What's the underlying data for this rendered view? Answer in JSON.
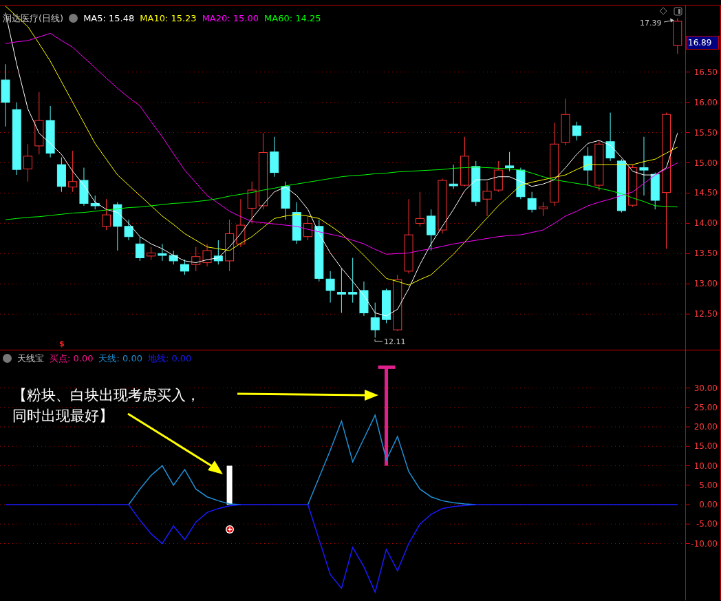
{
  "price_panel": {
    "title": "润达医疗(日线)",
    "moving_averages": [
      {
        "label": "MA5: 15.48",
        "color": "#ffffff"
      },
      {
        "label": "MA10: 15.23",
        "color": "#ffff00"
      },
      {
        "label": "MA20: 15.00",
        "color": "#ff00ff"
      },
      {
        "label": "MA60: 14.25",
        "color": "#00ff00"
      }
    ],
    "high_label": "17.39",
    "low_label": "12.11",
    "current_price": "16.89",
    "chart_data": {
      "type": "candlestick",
      "ylim": [
        11.9,
        17.6
      ],
      "grid": true,
      "ohlc": [
        [
          16.37,
          16.63,
          15.6,
          16.0
        ],
        [
          15.88,
          16.0,
          14.8,
          14.89
        ],
        [
          14.9,
          15.31,
          14.69,
          15.11
        ],
        [
          15.28,
          16.17,
          15.14,
          15.7
        ],
        [
          15.7,
          15.94,
          15.09,
          15.16
        ],
        [
          14.97,
          15.09,
          14.52,
          14.61
        ],
        [
          14.6,
          15.2,
          14.52,
          14.69
        ],
        [
          14.71,
          14.92,
          14.29,
          14.33
        ],
        [
          14.33,
          14.46,
          14.23,
          14.29
        ],
        [
          13.95,
          14.4,
          13.89,
          14.14
        ],
        [
          14.31,
          14.35,
          13.55,
          13.95
        ],
        [
          13.95,
          14.06,
          13.72,
          13.78
        ],
        [
          13.66,
          13.78,
          13.38,
          13.43
        ],
        [
          13.46,
          13.61,
          13.4,
          13.51
        ],
        [
          13.5,
          13.66,
          13.38,
          13.47
        ],
        [
          13.47,
          13.55,
          13.32,
          13.38
        ],
        [
          13.32,
          13.4,
          13.15,
          13.21
        ],
        [
          13.32,
          13.61,
          13.21,
          13.45
        ],
        [
          13.35,
          13.66,
          13.29,
          13.55
        ],
        [
          13.46,
          13.72,
          13.32,
          13.38
        ],
        [
          13.38,
          14.06,
          13.21,
          13.83
        ],
        [
          13.66,
          14.4,
          13.61,
          13.97
        ],
        [
          14.25,
          14.69,
          14.0,
          14.55
        ],
        [
          14.29,
          15.49,
          14.23,
          15.17
        ],
        [
          15.18,
          15.43,
          14.77,
          14.84
        ],
        [
          14.61,
          14.69,
          14.06,
          14.25
        ],
        [
          14.18,
          14.35,
          13.66,
          13.72
        ],
        [
          13.78,
          14.12,
          13.72,
          14.0
        ],
        [
          13.95,
          14.06,
          13.04,
          13.09
        ],
        [
          13.08,
          13.21,
          12.69,
          12.89
        ],
        [
          12.86,
          13.26,
          12.52,
          12.83
        ],
        [
          12.86,
          13.43,
          12.69,
          12.83
        ],
        [
          12.89,
          13.04,
          12.47,
          12.52
        ],
        [
          12.44,
          12.69,
          12.11,
          12.24
        ],
        [
          12.89,
          12.92,
          12.35,
          12.41
        ],
        [
          12.24,
          13.15,
          12.22,
          13.07
        ],
        [
          13.21,
          14.4,
          13.17,
          13.81
        ],
        [
          14.0,
          14.52,
          13.95,
          14.08
        ],
        [
          14.12,
          14.23,
          13.55,
          13.81
        ],
        [
          13.89,
          14.74,
          13.83,
          14.71
        ],
        [
          14.65,
          14.97,
          14.57,
          14.62
        ],
        [
          14.63,
          15.43,
          14.61,
          15.11
        ],
        [
          14.94,
          15.03,
          14.29,
          14.36
        ],
        [
          14.4,
          14.69,
          14.12,
          14.53
        ],
        [
          14.55,
          15.03,
          14.52,
          14.88
        ],
        [
          14.95,
          15.18,
          14.86,
          14.92
        ],
        [
          14.88,
          14.92,
          14.4,
          14.44
        ],
        [
          14.41,
          14.52,
          14.18,
          14.23
        ],
        [
          14.24,
          14.35,
          14.12,
          14.27
        ],
        [
          14.35,
          15.66,
          14.29,
          15.31
        ],
        [
          15.34,
          16.06,
          15.29,
          15.8
        ],
        [
          15.61,
          15.68,
          15.37,
          15.45
        ],
        [
          15.11,
          15.26,
          14.63,
          14.88
        ],
        [
          14.63,
          15.37,
          14.54,
          15.31
        ],
        [
          15.35,
          15.83,
          15.03,
          15.08
        ],
        [
          15.03,
          15.06,
          14.18,
          14.21
        ],
        [
          14.3,
          14.97,
          14.27,
          14.92
        ],
        [
          14.92,
          15.43,
          14.46,
          14.88
        ],
        [
          14.81,
          14.84,
          14.23,
          14.38
        ],
        [
          14.51,
          15.83,
          13.58,
          15.8
        ],
        [
          16.94,
          17.39,
          16.8,
          17.34
        ]
      ],
      "yticks": [
        {
          "value": 16.5,
          "label": "16.50"
        },
        {
          "value": 16,
          "label": "16.00"
        },
        {
          "value": 15.5,
          "label": "15.50"
        },
        {
          "value": 15,
          "label": "15.00"
        },
        {
          "value": 14.5,
          "label": "14.50"
        },
        {
          "value": 14,
          "label": "14.00"
        },
        {
          "value": 13.5,
          "label": "13.50"
        },
        {
          "value": 13,
          "label": "13.00"
        },
        {
          "value": 12.5,
          "label": "12.50"
        }
      ],
      "series": [
        {
          "type": "line",
          "color": "#ffffff",
          "values": [
            17.48,
            16.63,
            15.89,
            15.49,
            15.32,
            15.14,
            14.86,
            14.63,
            14.35,
            14.23,
            14.18,
            14.0,
            13.78,
            13.66,
            13.58,
            13.47,
            13.38,
            13.35,
            13.4,
            13.43,
            13.61,
            13.83,
            14.08,
            14.31,
            14.52,
            14.6,
            14.46,
            14.23,
            13.83,
            13.51,
            13.26,
            13.04,
            12.81,
            12.52,
            12.47,
            12.58,
            12.92,
            13.32,
            13.66,
            13.95,
            14.23,
            14.54,
            14.72,
            14.72,
            14.77,
            14.77,
            14.69,
            14.61,
            14.65,
            14.72,
            14.92,
            15.14,
            15.32,
            15.37,
            15.29,
            15.09,
            14.86,
            14.8,
            14.8,
            14.92,
            15.49
          ]
        },
        {
          "type": "line",
          "color": "#ffff00",
          "values": [
            17.59,
            17.42,
            17.25,
            16.97,
            16.68,
            16.34,
            16.0,
            15.66,
            15.32,
            15.06,
            14.8,
            14.63,
            14.46,
            14.29,
            14.12,
            13.98,
            13.83,
            13.72,
            13.61,
            13.58,
            13.55,
            13.67,
            13.78,
            13.93,
            14.08,
            14.12,
            14.15,
            14.12,
            14.08,
            13.96,
            13.83,
            13.65,
            13.47,
            13.28,
            13.09,
            13.04,
            12.98,
            13.07,
            13.15,
            13.32,
            13.49,
            13.69,
            13.89,
            14.09,
            14.29,
            14.46,
            14.63,
            14.68,
            14.72,
            14.76,
            14.8,
            14.89,
            14.97,
            14.97,
            14.97,
            14.97,
            14.97,
            15.02,
            15.06,
            15.16,
            15.26
          ]
        },
        {
          "type": "line",
          "color": "#ff00ff",
          "values": [
            16.97,
            17.0,
            17.02,
            17.08,
            17.14,
            17.02,
            16.91,
            16.74,
            16.57,
            16.4,
            16.23,
            16.08,
            15.94,
            15.68,
            15.43,
            15.15,
            14.88,
            14.67,
            14.46,
            14.33,
            14.2,
            14.11,
            14.03,
            14.01,
            13.99,
            13.97,
            13.95,
            13.9,
            13.86,
            13.82,
            13.78,
            13.72,
            13.66,
            13.57,
            13.49,
            13.5,
            13.51,
            13.55,
            13.58,
            13.62,
            13.66,
            13.69,
            13.72,
            13.75,
            13.78,
            13.8,
            13.81,
            13.85,
            13.89,
            14.0,
            14.12,
            14.2,
            14.29,
            14.35,
            14.4,
            14.46,
            14.52,
            14.66,
            14.8,
            14.9,
            15.0
          ]
        },
        {
          "type": "line",
          "color": "#00ff00",
          "values": [
            14.06,
            14.08,
            14.1,
            14.11,
            14.13,
            14.15,
            14.17,
            14.18,
            14.2,
            14.22,
            14.24,
            14.26,
            14.27,
            14.29,
            14.31,
            14.33,
            14.34,
            14.36,
            14.38,
            14.41,
            14.45,
            14.48,
            14.51,
            14.55,
            14.58,
            14.62,
            14.65,
            14.68,
            14.71,
            14.74,
            14.77,
            14.79,
            14.8,
            14.82,
            14.83,
            14.85,
            14.86,
            14.87,
            14.88,
            14.89,
            14.91,
            14.92,
            14.93,
            14.92,
            14.91,
            14.9,
            14.88,
            14.83,
            14.77,
            14.72,
            14.69,
            14.66,
            14.63,
            14.58,
            14.54,
            14.49,
            14.42,
            14.36,
            14.29,
            14.28,
            14.27
          ]
        }
      ]
    }
  },
  "indicator_panel": {
    "signal_mark": "$",
    "title": "天线宝",
    "readings": [
      {
        "label": "买点: 0.00",
        "color": "#ff1493"
      },
      {
        "label": "天线: 0.00",
        "color": "#1e90d6"
      },
      {
        "label": "地线: 0.00",
        "color": "#1a1aff"
      }
    ],
    "annotation": "【粉块、白块出现考虑买入，同时出现最好】",
    "chart_data": {
      "type": "line",
      "ylim": [
        -24.6,
        39.65
      ],
      "grid": true,
      "yticks": [
        {
          "value": 30,
          "label": "30.00"
        },
        {
          "value": 25,
          "label": "25.00"
        },
        {
          "value": 20,
          "label": "20.00"
        },
        {
          "value": 15,
          "label": "15.00"
        },
        {
          "value": 10,
          "label": "10.00"
        },
        {
          "value": 5,
          "label": "5.00"
        },
        {
          "value": 0,
          "label": "0.00"
        },
        {
          "value": -5,
          "label": "-5.00"
        },
        {
          "value": -10,
          "label": "-10.00"
        }
      ],
      "series": [
        {
          "type": "bar",
          "color": "#ffffff",
          "values": [
            null,
            null,
            null,
            null,
            null,
            null,
            null,
            null,
            null,
            null,
            null,
            null,
            null,
            null,
            null,
            null,
            null,
            null,
            null,
            null,
            10,
            null,
            null,
            null,
            null,
            null,
            null,
            null,
            null,
            null,
            null,
            null,
            null,
            null,
            null,
            null,
            null,
            null,
            null,
            null,
            null,
            null,
            null,
            null,
            null,
            null,
            null,
            null,
            null,
            null,
            null,
            null,
            null,
            null,
            null,
            null,
            null,
            null,
            null,
            null,
            null
          ]
        },
        {
          "type": "bar",
          "color": "#e0208c",
          "base": [
            null,
            null,
            null,
            null,
            null,
            null,
            null,
            null,
            null,
            null,
            null,
            null,
            null,
            null,
            null,
            null,
            null,
            null,
            null,
            null,
            null,
            null,
            null,
            null,
            null,
            null,
            null,
            null,
            null,
            null,
            null,
            null,
            null,
            null,
            10,
            null,
            null,
            null,
            null,
            null,
            null,
            null,
            null,
            null,
            null,
            null,
            null,
            null,
            null,
            null,
            null,
            null,
            null,
            null,
            null,
            null,
            null,
            null,
            null,
            null,
            null
          ],
          "values": [
            null,
            null,
            null,
            null,
            null,
            null,
            null,
            null,
            null,
            null,
            null,
            null,
            null,
            null,
            null,
            null,
            null,
            null,
            null,
            null,
            null,
            null,
            null,
            null,
            null,
            null,
            null,
            null,
            null,
            null,
            null,
            null,
            null,
            null,
            25.6,
            null,
            null,
            null,
            null,
            null,
            null,
            null,
            null,
            null,
            null,
            null,
            null,
            null,
            null,
            null,
            null,
            null,
            null,
            null,
            null,
            null,
            null,
            null,
            null,
            null,
            null
          ]
        },
        {
          "color": "#1e90d6",
          "values": [
            null,
            null,
            null,
            null,
            null,
            null,
            null,
            null,
            null,
            null,
            null,
            0,
            4,
            7.5,
            10,
            5,
            9,
            4,
            2,
            1,
            0.2,
            0,
            null,
            null,
            null,
            null,
            null,
            0,
            7,
            14,
            21.5,
            11,
            17,
            23,
            11.5,
            17.5,
            8.5,
            4,
            2,
            1,
            0.5,
            0.2,
            0,
            null,
            null,
            null,
            null,
            null,
            null,
            null,
            null,
            null,
            null,
            null,
            null,
            null,
            null,
            null,
            null,
            null,
            null
          ]
        },
        {
          "color": "#1a1aff",
          "values": [
            0,
            0,
            0,
            0,
            0,
            0,
            0,
            0,
            0,
            0,
            0,
            0,
            -4,
            -7.5,
            -10,
            -5.5,
            -9,
            -4.5,
            -2,
            -1,
            -0.3,
            0,
            0,
            0,
            0,
            0,
            0,
            0,
            -9,
            -18,
            -21.5,
            -11,
            -16,
            -22.5,
            -11.5,
            -17,
            -10,
            -5,
            -2.5,
            -1,
            -0.5,
            -0.2,
            0,
            0,
            0,
            0,
            0,
            0,
            0,
            0,
            0,
            0,
            0,
            0,
            0,
            0,
            0,
            0,
            0,
            0,
            0
          ]
        }
      ]
    }
  }
}
